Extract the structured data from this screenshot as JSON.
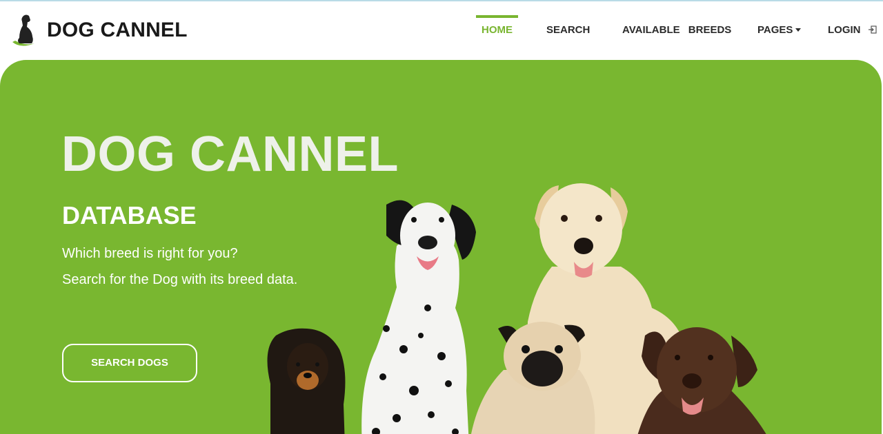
{
  "brand": {
    "name": "DOG CANNEL",
    "logo_icon": "dog-logo-icon"
  },
  "nav": {
    "items": [
      {
        "label": "HOME",
        "active": true
      },
      {
        "label": "SEARCH"
      },
      {
        "label": "AVAILABLE",
        "label2": "BREEDS"
      },
      {
        "label": "PAGES",
        "icon": "caret-down-icon"
      },
      {
        "label": "LOGIN",
        "icon": "login-icon"
      }
    ]
  },
  "hero": {
    "title": "DOG CANNEL",
    "subtitle": "DATABASE",
    "line1": "Which breed is right for you?",
    "line2": "Search for the Dog with its breed data.",
    "button_label": "SEARCH DOGS",
    "dogs": [
      "cocker-spaniel",
      "dalmatian",
      "golden-retriever",
      "pug",
      "chocolate-labrador"
    ]
  },
  "colors": {
    "accent": "#79b730",
    "nav_text": "#2b2b2b",
    "title": "#eef1ea"
  }
}
